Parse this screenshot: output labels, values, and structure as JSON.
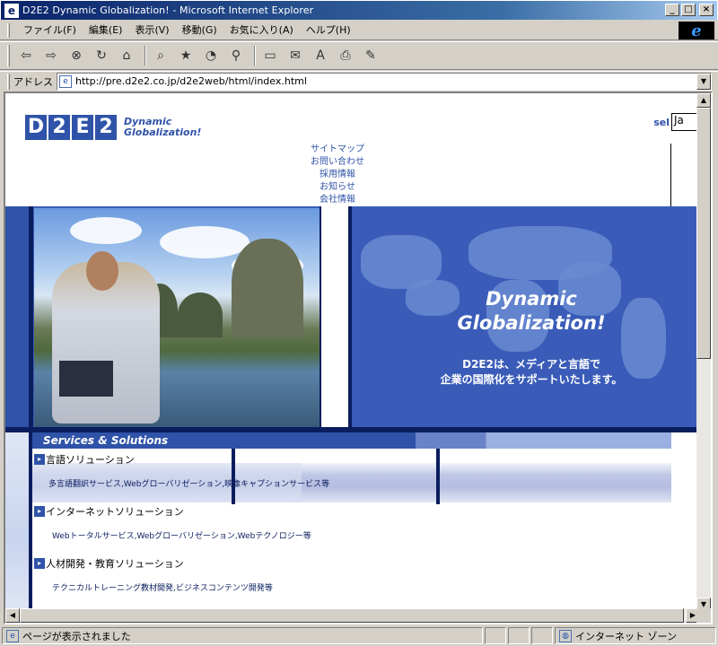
{
  "window": {
    "title": "D2E2 Dynamic Globalization! - Microsoft Internet Explorer",
    "buttons": {
      "minimize": "_",
      "maximize": "□",
      "close": "×"
    }
  },
  "menu": {
    "items": [
      {
        "label": "ファイル(F)"
      },
      {
        "label": "編集(E)"
      },
      {
        "label": "表示(V)"
      },
      {
        "label": "移動(G)"
      },
      {
        "label": "お気に入り(A)"
      },
      {
        "label": "ヘルプ(H)"
      }
    ]
  },
  "toolbar": {
    "buttons": [
      {
        "icon": "back-icon",
        "glyph": "⇦"
      },
      {
        "icon": "forward-icon",
        "glyph": "⇨"
      },
      {
        "icon": "stop-icon",
        "glyph": "⊗"
      },
      {
        "icon": "refresh-icon",
        "glyph": "↻"
      },
      {
        "icon": "home-icon",
        "glyph": "⌂"
      },
      {
        "icon": "search-icon",
        "glyph": "⌕"
      },
      {
        "icon": "favorites-icon",
        "glyph": "★"
      },
      {
        "icon": "history-icon",
        "glyph": "◔"
      },
      {
        "icon": "channels-icon",
        "glyph": "⚲"
      },
      {
        "icon": "fullscreen-icon",
        "glyph": "▭"
      },
      {
        "icon": "mail-icon",
        "glyph": "✉"
      },
      {
        "icon": "font-icon",
        "glyph": "A"
      },
      {
        "icon": "print-icon",
        "glyph": "⎙"
      },
      {
        "icon": "edit-icon",
        "glyph": "✎"
      }
    ]
  },
  "address": {
    "label": "アドレス",
    "url": "http://pre.d2e2.co.jp/d2e2web/html/index.html"
  },
  "page": {
    "logo": {
      "letters": [
        "D",
        "2",
        "E",
        "2"
      ],
      "tagline_1": "Dynamic",
      "tagline_2": "Globalization!"
    },
    "lang": {
      "label": "sel",
      "value": "Ja"
    },
    "nav": [
      {
        "label": "サイトマップ"
      },
      {
        "label": "お問い合わせ"
      },
      {
        "label": "採用情報"
      },
      {
        "label": "お知らせ"
      },
      {
        "label": "会社情報"
      }
    ],
    "hero": {
      "title_1": "Dynamic",
      "title_2": "Globalization!",
      "sub_1": "D2E2は、メディアと言語で",
      "sub_2": "企業の国際化をサポートいたします。"
    },
    "services": {
      "header": "Services & Solutions",
      "rows": [
        {
          "title": "言語ソリューション",
          "desc": "多言語翻訳サービス,Webグローバリゼーション,映像キャプションサービス等"
        },
        {
          "title": "インターネットソリューション",
          "desc": "Webトータルサービス,Webグローバリゼーション,Webテクノロジー等"
        },
        {
          "title": "人材開発・教育ソリューション",
          "desc": "テクニカルトレーニング教材開発,ビジネスコンテンツ開発等"
        }
      ]
    }
  },
  "status": {
    "text": "ページが表示されました",
    "zone": "インターネット ゾーン"
  },
  "colors": {
    "brand": "#2f53a8",
    "dark": "#0a1d5e",
    "hero": "#3a5cb8"
  }
}
